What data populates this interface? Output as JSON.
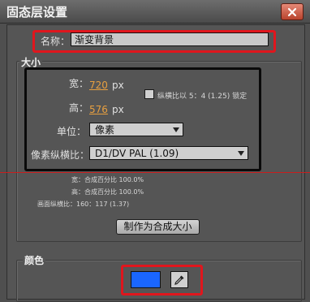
{
  "window": {
    "title": "固态层设置",
    "close_symbol": "×"
  },
  "name": {
    "label": "名称：",
    "value": "渐变背景"
  },
  "size": {
    "section_title": "大小",
    "width_label": "宽：",
    "width_value": "720",
    "width_unit": "px",
    "height_label": "高：",
    "height_value": "576",
    "height_unit": "px",
    "lock_label": "纵横比以 5：4 (1.25) 锁定",
    "lock_checked": false,
    "unit_label": "单位：",
    "unit_value": "像素",
    "pixel_aspect_label": "像素纵横比：",
    "pixel_aspect_value": "D1/DV PAL (1.09)",
    "info_width": "宽：合成百分比 100.0%",
    "info_height": "高：合成百分比 100.0%",
    "info_frame_aspect": "画面纵横比：160：117 (1.37)",
    "make_comp_size_button": "制作为合成大小"
  },
  "color": {
    "section_title": "颜色",
    "swatch_color": "#1a66ff"
  },
  "annotation_colors": {
    "red": "#e0161d",
    "black": "#0a0a0a"
  }
}
